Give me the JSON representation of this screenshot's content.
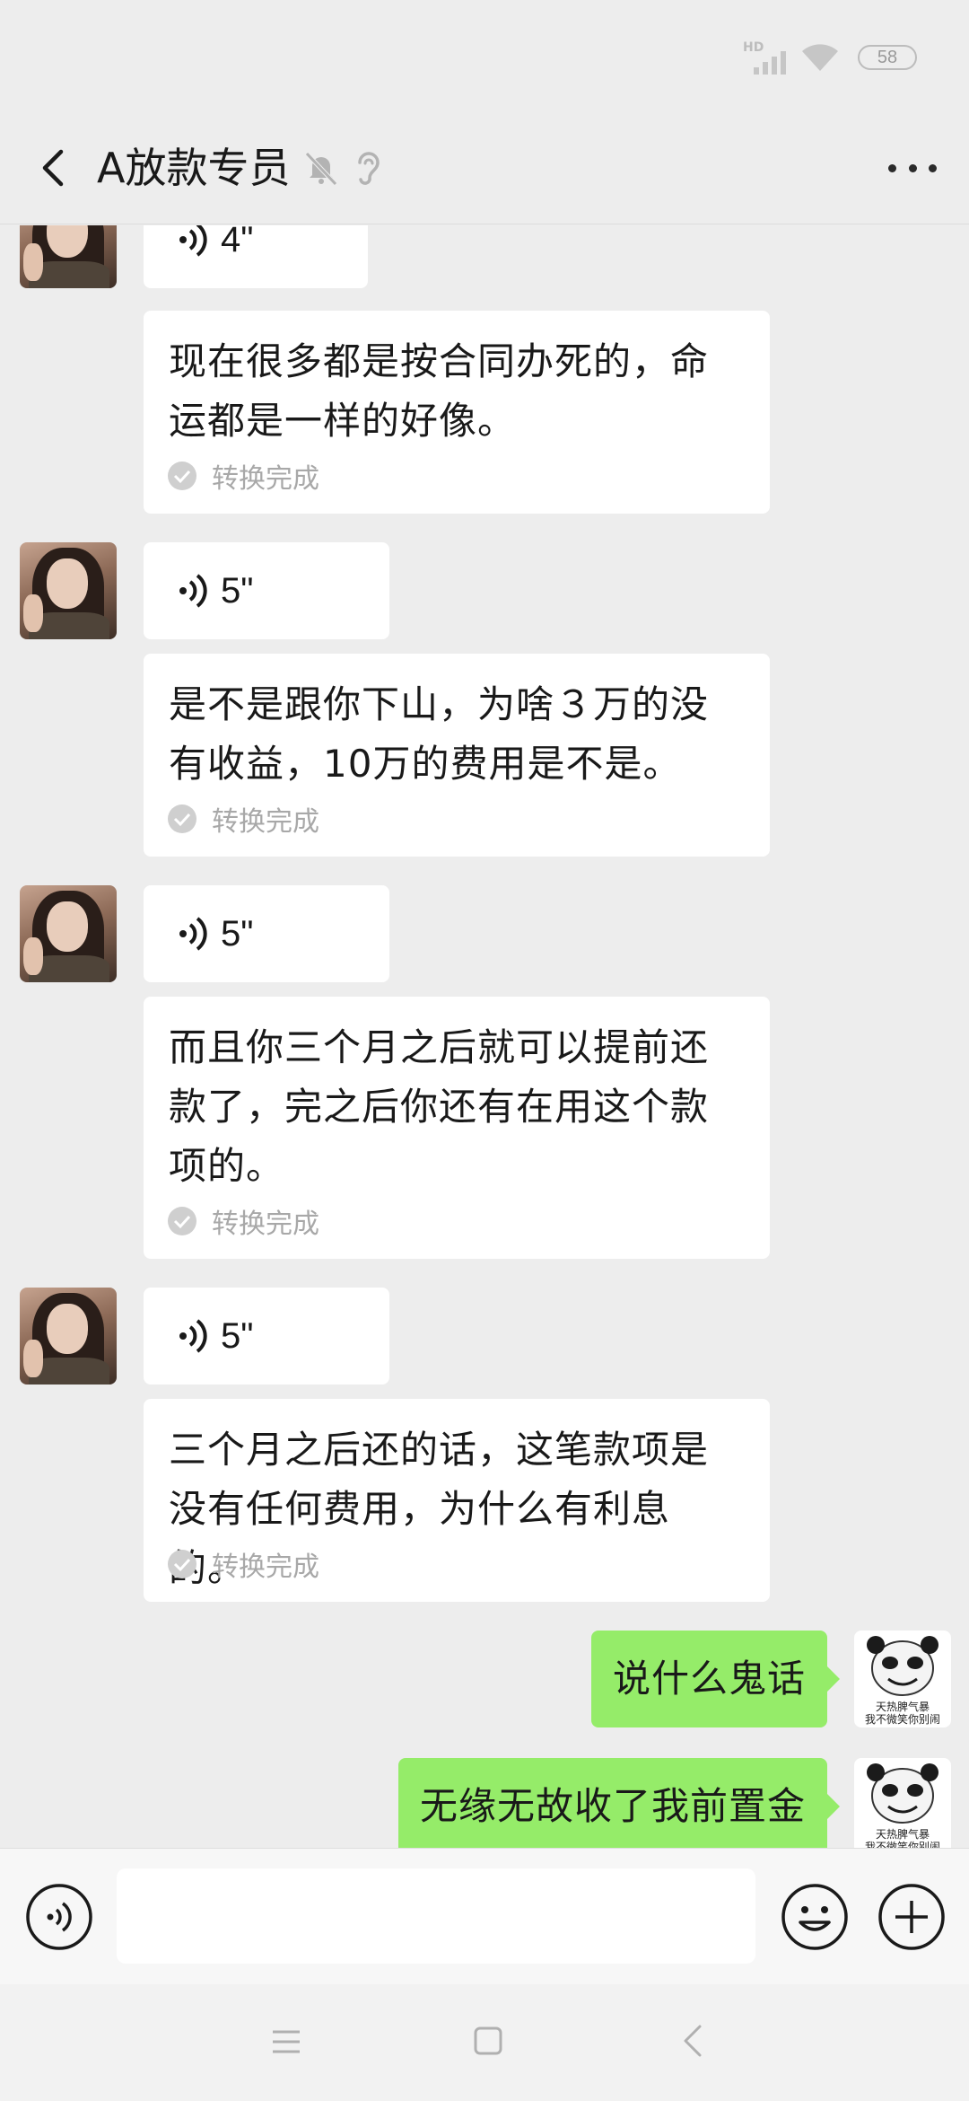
{
  "status_bar": {
    "network_label": "HD",
    "battery_level": "58"
  },
  "header": {
    "title": "A放款专员"
  },
  "messages": [
    {
      "voice_duration": "4\"",
      "transcript": "现在很多都是按合同办死的，命运都是一样的好像。",
      "status": "转换完成"
    },
    {
      "voice_duration": "5\"",
      "transcript": "是不是跟你下山，为啥３万的没有收益，10万的费用是不是。",
      "status": "转换完成"
    },
    {
      "voice_duration": "5\"",
      "transcript": "而且你三个月之后就可以提前还款了，完之后你还有在用这个款项的。",
      "status": "转换完成"
    },
    {
      "voice_duration": "5\"",
      "transcript": "三个月之后还的话，这笔款项是没有任何费用，为什么有利息的。",
      "status": "转换完成"
    }
  ],
  "my_messages": [
    {
      "text": "说什么鬼话",
      "avatar_caption_1": "天热脾气暴",
      "avatar_caption_2": "我不微笑你别闹"
    },
    {
      "text": "无缘无故收了我前置金",
      "avatar_caption_1": "天热脾气暴",
      "avatar_caption_2": "我不微笑你别闹"
    }
  ],
  "input": {
    "placeholder": "",
    "value": ""
  },
  "colors": {
    "background": "#ededed",
    "my_bubble": "#95ec69",
    "other_bubble": "#ffffff"
  },
  "icons": [
    "back-icon",
    "mute-icon",
    "ear-icon",
    "more-icon",
    "voice-wave-icon",
    "check-circle-icon",
    "voice-toggle-icon",
    "emoji-icon",
    "plus-icon",
    "menu-icon",
    "home-icon",
    "back-nav-icon"
  ]
}
